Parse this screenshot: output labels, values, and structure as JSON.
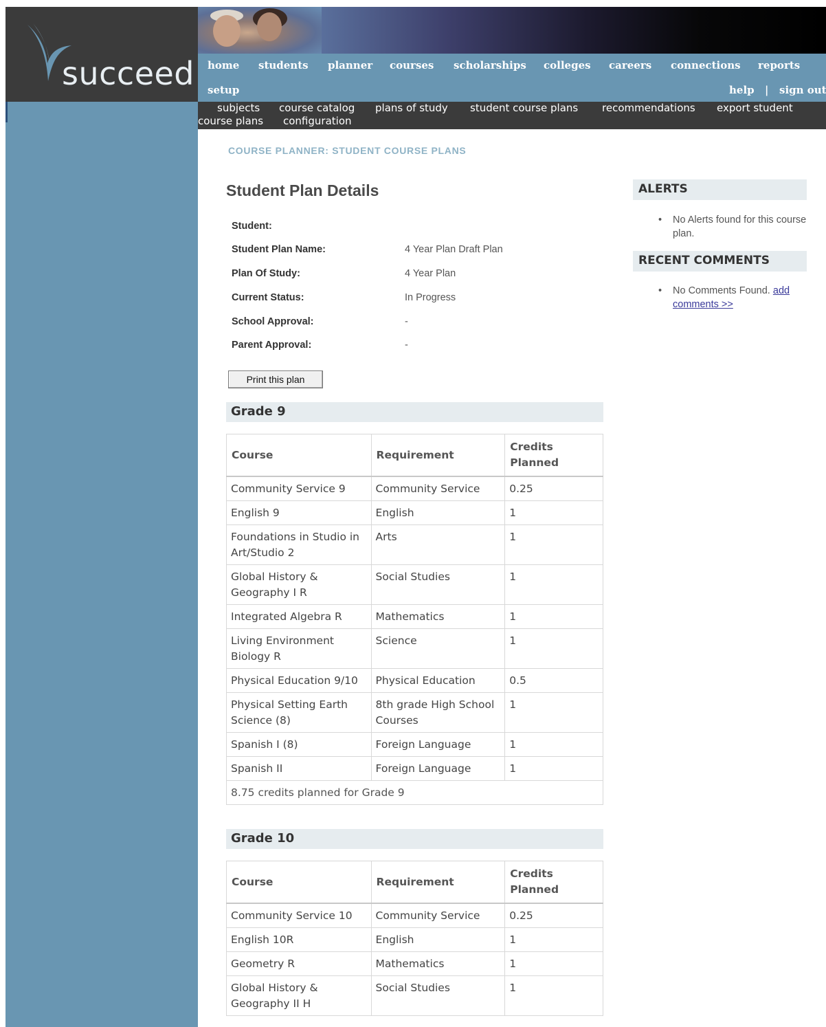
{
  "brand": {
    "logo_text": "succeed"
  },
  "nav": {
    "items": [
      "home",
      "students",
      "planner",
      "courses",
      "scholarships",
      "colleges",
      "careers",
      "connections",
      "reports"
    ],
    "setup": "setup",
    "help": "help",
    "separator": "|",
    "sign_out": "sign out"
  },
  "subnav": {
    "subjects": "subjects",
    "course_catalog": "course catalog",
    "plans_of_study": "plans of study",
    "student_course_plans": "student course plans",
    "recommendations": "recommendations",
    "export_student": "export student",
    "course_plans": "course plans",
    "configuration": "configuration"
  },
  "breadcrumb": "COURSE PLANNER: STUDENT COURSE PLANS",
  "page_title": "Student Plan Details",
  "details": {
    "student_label": "Student:",
    "student_value": "",
    "plan_name_label": "Student Plan Name:",
    "plan_name_value": "4 Year Plan Draft Plan",
    "plan_of_study_label": "Plan Of Study:",
    "plan_of_study_value": "4 Year Plan",
    "status_label": "Current Status:",
    "status_value": "In Progress",
    "school_approval_label": "School Approval:",
    "school_approval_value": "-",
    "parent_approval_label": "Parent Approval:",
    "parent_approval_value": "-"
  },
  "print_button": "Print this plan",
  "columns": {
    "course": "Course",
    "requirement": "Requirement",
    "credits_line1": "Credits",
    "credits_line2": "Planned"
  },
  "grade9": {
    "title": "Grade 9",
    "summary": "8.75 credits planned for Grade 9",
    "rows": [
      {
        "course": "Community Service 9",
        "requirement": "Community Service",
        "credits": "0.25"
      },
      {
        "course": "English 9",
        "requirement": "English",
        "credits": "1"
      },
      {
        "course": "Foundations in Studio in Art/Studio 2",
        "requirement": "Arts",
        "credits": "1"
      },
      {
        "course": "Global History & Geography I R",
        "requirement": "Social Studies",
        "credits": "1"
      },
      {
        "course": "Integrated Algebra R",
        "requirement": "Mathematics",
        "credits": "1"
      },
      {
        "course": "Living Environment Biology R",
        "requirement": "Science",
        "credits": "1"
      },
      {
        "course": "Physical Education 9/10",
        "requirement": "Physical Education",
        "credits": "0.5"
      },
      {
        "course": "Physical Setting Earth Science (8)",
        "requirement": "8th grade High School Courses",
        "credits": "1"
      },
      {
        "course": "Spanish I (8)",
        "requirement": "Foreign Language",
        "credits": "1"
      },
      {
        "course": "Spanish II",
        "requirement": "Foreign Language",
        "credits": "1"
      }
    ]
  },
  "grade10": {
    "title": "Grade 10",
    "rows": [
      {
        "course": "Community Service 10",
        "requirement": "Community Service",
        "credits": "0.25"
      },
      {
        "course": "English 10R",
        "requirement": "English",
        "credits": "1"
      },
      {
        "course": "Geometry R",
        "requirement": "Mathematics",
        "credits": "1"
      },
      {
        "course": "Global History & Geography II H",
        "requirement": "Social Studies",
        "credits": "1"
      }
    ]
  },
  "alerts": {
    "title": "ALERTS",
    "message": "No Alerts found for this course plan."
  },
  "comments": {
    "title": "RECENT COMMENTS",
    "message": "No Comments Found.",
    "link_line1": "add",
    "link_line2": "comments >>"
  },
  "colors": {
    "accent_blue": "#6996b2",
    "dark_gray": "#3b3b3b",
    "heading_bg": "#e6ecef",
    "breadcrumb": "#8fb3c6"
  },
  "icons": {
    "bullet": "•"
  }
}
